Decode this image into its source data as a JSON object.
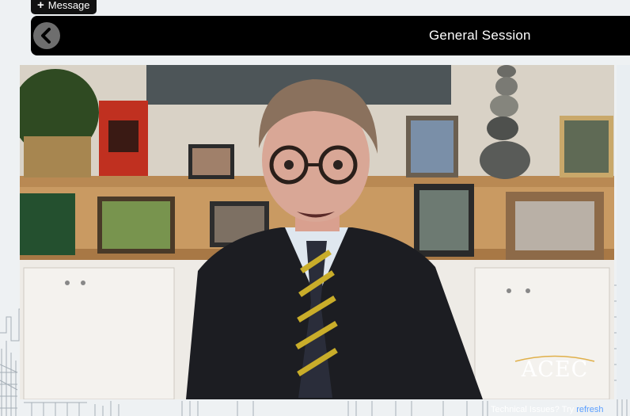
{
  "message_button": {
    "icon": "plus-icon",
    "label": "Message"
  },
  "header": {
    "title": "General Session",
    "back_icon": "chevron-left-icon"
  },
  "video": {
    "logo_text": "ACEC"
  },
  "ticker": {
    "text": "Technical Issues? Try ",
    "link": "refresh"
  },
  "colors": {
    "header_bg": "#000000",
    "accent_link": "#5b9fff",
    "logo": "#ffffff"
  }
}
